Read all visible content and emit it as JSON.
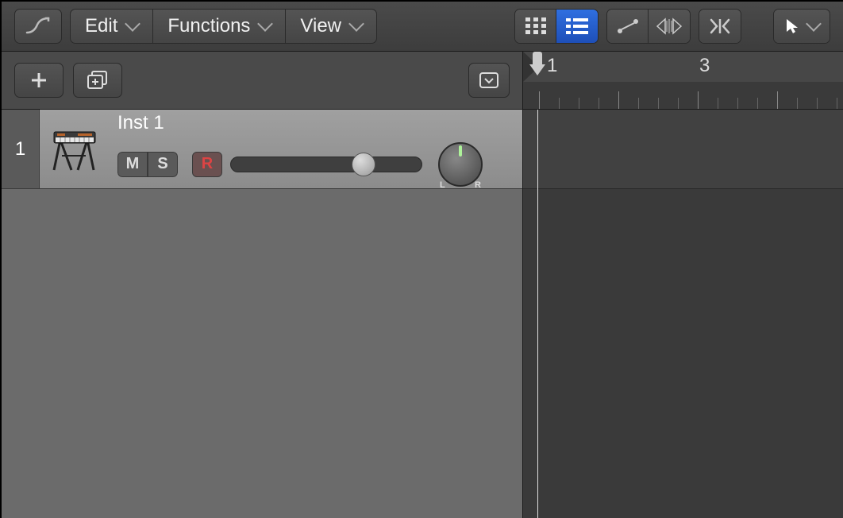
{
  "toolbar": {
    "menus": {
      "edit": "Edit",
      "functions": "Functions",
      "view": "View"
    }
  },
  "ruler": {
    "marker1": "1",
    "marker2": "3"
  },
  "track": {
    "number": "1",
    "name": "Inst 1",
    "mute": "M",
    "solo": "S",
    "record": "R",
    "pan_left": "L",
    "pan_right": "R",
    "volume_percent": 63,
    "pan_value": 0
  },
  "colors": {
    "active_button": "#2f6fe0",
    "record_text": "#d44444"
  }
}
